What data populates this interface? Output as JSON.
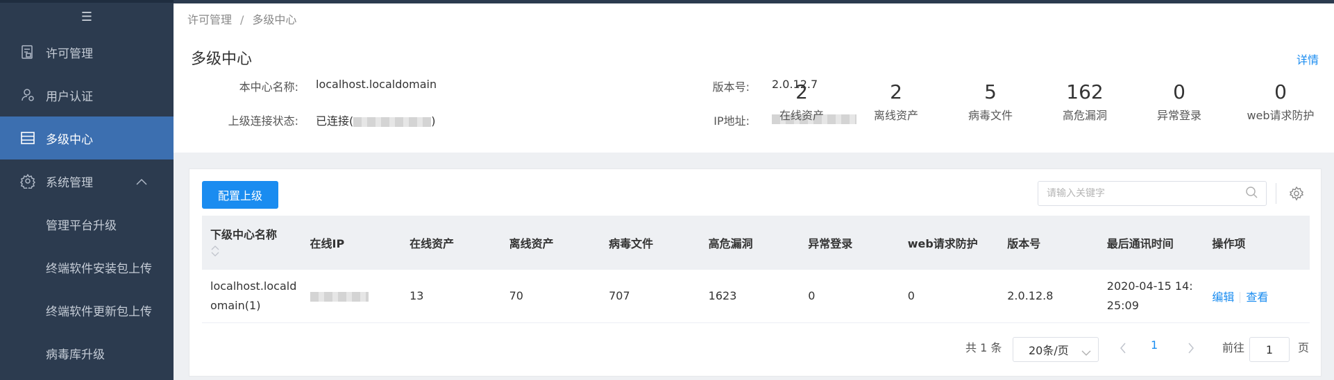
{
  "sidebar": {
    "menu_icon": "hamburger-icon",
    "items": [
      {
        "label": "许可管理",
        "icon": "license-icon",
        "active": false
      },
      {
        "label": "用户认证",
        "icon": "user-icon",
        "active": false
      },
      {
        "label": "多级中心",
        "icon": "multi-center-icon",
        "active": true
      },
      {
        "label": "系统管理",
        "icon": "gear-icon",
        "active": false,
        "expanded": true
      }
    ],
    "sub_items": [
      {
        "label": "管理平台升级"
      },
      {
        "label": "终端软件安装包上传"
      },
      {
        "label": "终端软件更新包上传"
      },
      {
        "label": "病毒库升级"
      }
    ]
  },
  "breadcrumb": {
    "parent": "许可管理",
    "separator": "/",
    "current": "多级中心"
  },
  "header": {
    "title": "多级中心",
    "detail_link": "详情",
    "center_name_label": "本中心名称:",
    "center_name_value": "localhost.localdomain",
    "version_label": "版本号:",
    "version_value": "2.0.12.7",
    "upstream_label": "上级连接状态:",
    "upstream_value_prefix": "已连接(",
    "upstream_value_suffix": ")",
    "ip_label": "IP地址:"
  },
  "stats": [
    {
      "value": "2",
      "label": "在线资产"
    },
    {
      "value": "2",
      "label": "离线资产"
    },
    {
      "value": "5",
      "label": "病毒文件"
    },
    {
      "value": "162",
      "label": "高危漏洞"
    },
    {
      "value": "0",
      "label": "异常登录"
    },
    {
      "value": "0",
      "label": "web请求防护"
    }
  ],
  "toolbar": {
    "config_button": "配置上级",
    "search_placeholder": "请输入关键字"
  },
  "table": {
    "columns": [
      "下级中心名称",
      "在线IP",
      "在线资产",
      "离线资产",
      "病毒文件",
      "高危漏洞",
      "异常登录",
      "web请求防护",
      "版本号",
      "最后通讯时间",
      "操作项"
    ],
    "rows": [
      {
        "name_line1": "localhost.locald",
        "name_line2": "omain(1)",
        "online_assets": "13",
        "offline_assets": "70",
        "virus_files": "707",
        "high_risk": "1623",
        "abnormal_login": "0",
        "web_protect": "0",
        "version": "2.0.12.8",
        "last_time_line1": "2020-04-15 14:",
        "last_time_line2": "25:09",
        "edit": "编辑",
        "view": "查看"
      }
    ]
  },
  "pagination": {
    "total": "共 1 条",
    "page_size": "20条/页",
    "current_page": "1",
    "goto_label": "前往",
    "goto_value": "1",
    "page_suffix": "页"
  },
  "colors": {
    "sidebar_bg": "#2c3b4f",
    "active_bg": "#3c6fb0",
    "primary": "#1a8cf0"
  }
}
